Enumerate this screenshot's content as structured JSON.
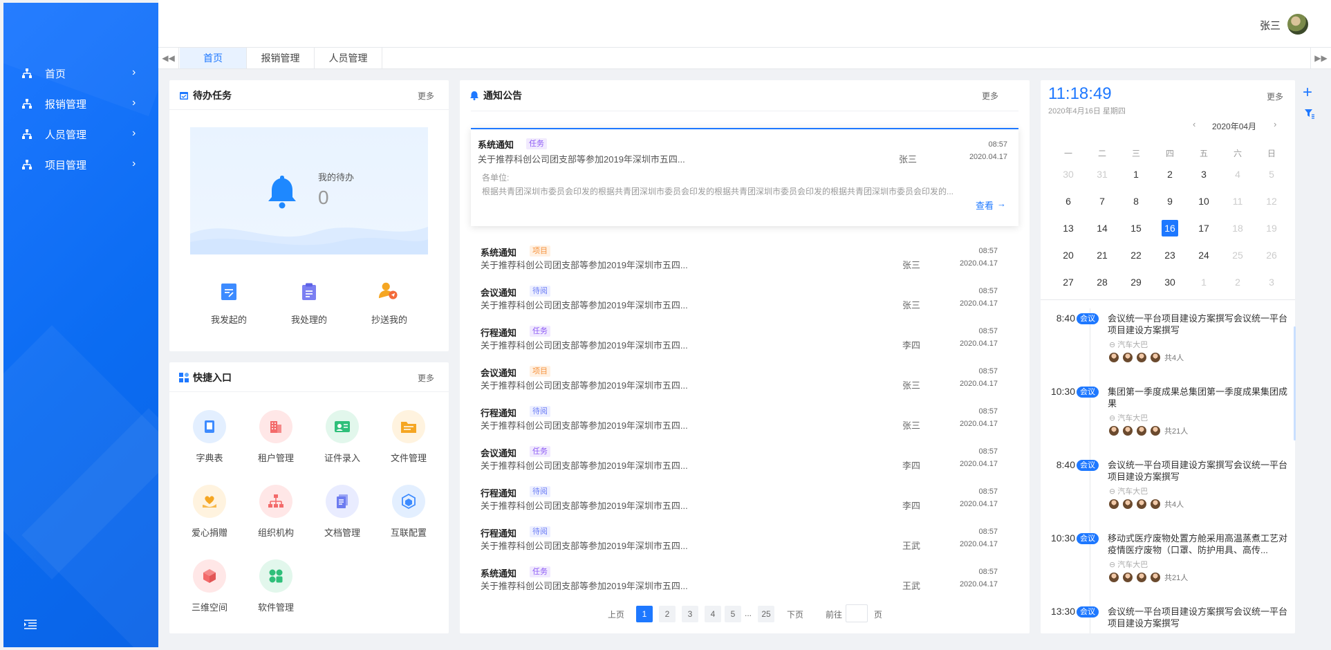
{
  "sidebar": {
    "items": [
      {
        "label": "首页"
      },
      {
        "label": "报销管理"
      },
      {
        "label": "人员管理"
      },
      {
        "label": "项目管理"
      }
    ]
  },
  "header": {
    "user_name": "张三"
  },
  "tabs": [
    {
      "label": "首页",
      "active": true
    },
    {
      "label": "报销管理"
    },
    {
      "label": "人员管理"
    }
  ],
  "todo": {
    "title": "待办任务",
    "more": "更多",
    "my_todo_label": "我的待办",
    "my_todo_count": "0",
    "actions": [
      {
        "label": "我发起的",
        "icon": "edit-doc-icon"
      },
      {
        "label": "我处理的",
        "icon": "clipboard-icon"
      },
      {
        "label": "抄送我的",
        "icon": "user-send-icon"
      }
    ]
  },
  "quick": {
    "title": "快捷入口",
    "more": "更多",
    "items": [
      {
        "label": "字典表",
        "icon": "book-icon",
        "color": "#3d8bff",
        "bg": "#e3efff"
      },
      {
        "label": "租户管理",
        "icon": "building-icon",
        "color": "#f36a6a",
        "bg": "#ffe7e7"
      },
      {
        "label": "证件录入",
        "icon": "id-card-icon",
        "color": "#2fbf7a",
        "bg": "#e2f7ec"
      },
      {
        "label": "文件管理",
        "icon": "folder-icon",
        "color": "#f5a623",
        "bg": "#fff3df"
      },
      {
        "label": "爱心捐赠",
        "icon": "heart-hand-icon",
        "color": "#f5a623",
        "bg": "#fff3df"
      },
      {
        "label": "组织机构",
        "icon": "org-chart-icon",
        "color": "#f36a6a",
        "bg": "#ffe7e7"
      },
      {
        "label": "文档管理",
        "icon": "documents-icon",
        "color": "#6d7cf0",
        "bg": "#e9ecff"
      },
      {
        "label": "互联配置",
        "icon": "cube-link-icon",
        "color": "#3d8bff",
        "bg": "#e3efff"
      },
      {
        "label": "三维空间",
        "icon": "3d-cube-icon",
        "color": "#f36a6a",
        "bg": "#ffe7e7"
      },
      {
        "label": "软件管理",
        "icon": "apps-icon",
        "color": "#2fbf7a",
        "bg": "#e2f7ec"
      }
    ]
  },
  "notice": {
    "title": "通知公告",
    "more": "更多",
    "featured": {
      "type": "系统通知",
      "tag": "任务",
      "tag_kind": "task",
      "title": "关于推荐科创公司团支部等参加2019年深圳市五四...",
      "person": "张三",
      "time": "08:57",
      "date": "2020.04.17",
      "addressee": "各单位:",
      "body": "根据共青团深圳市委员会印发的根据共青团深圳市委员会印发的根据共青团深圳市委员会印发的根据共青团深圳市委员会印发的...",
      "view": "查看"
    },
    "rows": [
      {
        "type": "系统通知",
        "tag": "项目",
        "tag_kind": "proj",
        "title": "关于推荐科创公司团支部等参加2019年深圳市五四...",
        "person": "张三",
        "time": "08:57",
        "date": "2020.04.17"
      },
      {
        "type": "会议通知",
        "tag": "待阅",
        "tag_kind": "read",
        "title": "关于推荐科创公司团支部等参加2019年深圳市五四...",
        "person": "张三",
        "time": "08:57",
        "date": "2020.04.17"
      },
      {
        "type": "行程通知",
        "tag": "任务",
        "tag_kind": "task",
        "title": "关于推荐科创公司团支部等参加2019年深圳市五四...",
        "person": "李四",
        "time": "08:57",
        "date": "2020.04.17"
      },
      {
        "type": "会议通知",
        "tag": "项目",
        "tag_kind": "proj",
        "title": "关于推荐科创公司团支部等参加2019年深圳市五四...",
        "person": "张三",
        "time": "08:57",
        "date": "2020.04.17"
      },
      {
        "type": "行程通知",
        "tag": "待阅",
        "tag_kind": "read",
        "title": "关于推荐科创公司团支部等参加2019年深圳市五四...",
        "person": "张三",
        "time": "08:57",
        "date": "2020.04.17"
      },
      {
        "type": "会议通知",
        "tag": "任务",
        "tag_kind": "task",
        "title": "关于推荐科创公司团支部等参加2019年深圳市五四...",
        "person": "李四",
        "time": "08:57",
        "date": "2020.04.17"
      },
      {
        "type": "行程通知",
        "tag": "待阅",
        "tag_kind": "read",
        "title": "关于推荐科创公司团支部等参加2019年深圳市五四...",
        "person": "李四",
        "time": "08:57",
        "date": "2020.04.17"
      },
      {
        "type": "行程通知",
        "tag": "待阅",
        "tag_kind": "read",
        "title": "关于推荐科创公司团支部等参加2019年深圳市五四...",
        "person": "王武",
        "time": "08:57",
        "date": "2020.04.17"
      },
      {
        "type": "系统通知",
        "tag": "任务",
        "tag_kind": "task",
        "title": "关于推荐科创公司团支部等参加2019年深圳市五四...",
        "person": "王武",
        "time": "08:57",
        "date": "2020.04.17"
      }
    ],
    "pager": {
      "prev": "上页",
      "pages": [
        "1",
        "2",
        "3",
        "4",
        "5"
      ],
      "ellipsis": "...",
      "last": "25",
      "current": "1",
      "next": "下页",
      "goto_label": "前往",
      "goto_value": "",
      "page_unit": "页"
    }
  },
  "calendar": {
    "clock": "11:18:49",
    "date_line": "2020年4月16日 星期四",
    "more": "更多",
    "month_label": "2020年04月",
    "prev": "‹",
    "next": "›",
    "weekdays": [
      "一",
      "二",
      "三",
      "四",
      "五",
      "六",
      "日"
    ],
    "days": [
      [
        "30",
        "31",
        "1",
        "2",
        "3",
        "4",
        "5"
      ],
      [
        "6",
        "7",
        "8",
        "9",
        "10",
        "11",
        "12"
      ],
      [
        "13",
        "14",
        "15",
        "16",
        "17",
        "18",
        "19"
      ],
      [
        "20",
        "21",
        "22",
        "23",
        "24",
        "25",
        "26"
      ],
      [
        "27",
        "28",
        "29",
        "30",
        "1",
        "2",
        "3"
      ]
    ],
    "today": "16",
    "events": [
      {
        "time": "8:40",
        "tag": "会议",
        "title": "会议统一平台项目建设方案撰写会议统一平台项目建设方案撰写",
        "location": "汽车大巴",
        "people": "共4人"
      },
      {
        "time": "10:30",
        "tag": "会议",
        "title": "集团第一季度成果总集团第一季度成果集团成果",
        "location": "汽车大巴",
        "people": "共21人"
      },
      {
        "time": "8:40",
        "tag": "会议",
        "title": "会议统一平台项目建设方案撰写会议统一平台项目建设方案撰写",
        "location": "汽车大巴",
        "people": "共4人"
      },
      {
        "time": "10:30",
        "tag": "会议",
        "title": "移动式医疗废物处置方舱采用高温蒸煮工艺对疫情医疗废物（口罩、防护用具、高传...",
        "location": "汽车大巴",
        "people": "共21人"
      },
      {
        "time": "13:30",
        "tag": "会议",
        "title": "会议统一平台项目建设方案撰写会议统一平台项目建设方案撰写",
        "location": "",
        "people": ""
      }
    ]
  },
  "colors": {
    "primary": "#1e78ff",
    "sidebar": "#0b6cf2"
  }
}
